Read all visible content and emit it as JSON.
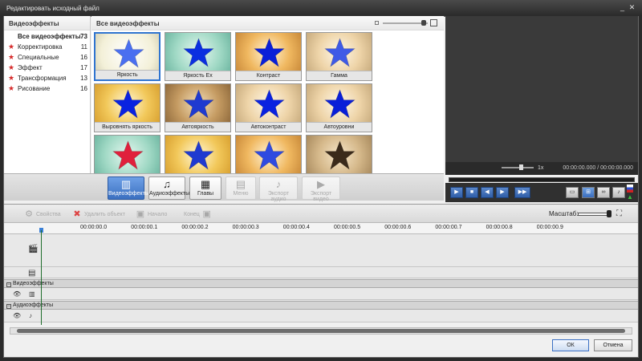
{
  "window": {
    "title": "Редактировать исходный файл"
  },
  "categories": {
    "header": "Видеоэффекты",
    "items": [
      {
        "label": "Все видеоэффекты",
        "count": "73"
      },
      {
        "label": "Корректировка",
        "count": "11"
      },
      {
        "label": "Специальные",
        "count": "16"
      },
      {
        "label": "Эффект",
        "count": "17"
      },
      {
        "label": "Трансформация",
        "count": "13"
      },
      {
        "label": "Рисование",
        "count": "16"
      }
    ]
  },
  "gallery": {
    "header": "Все видеоэффекты",
    "tiles": [
      {
        "label": "Яркость",
        "star_color": "#4a6ff0",
        "bg": "bg-white"
      },
      {
        "label": "Яркость Ex",
        "star_color": "#0a2fe0",
        "bg": "bg-teal"
      },
      {
        "label": "Контраст",
        "star_color": "#0a1fd8",
        "bg": "bg-orange"
      },
      {
        "label": "Гамма",
        "star_color": "#3f5ae6",
        "bg": "bg-tan"
      },
      {
        "label": "Выровнять яркость",
        "star_color": "#0a22e0",
        "bg": "bg-yellow"
      },
      {
        "label": "Автояркость",
        "star_color": "#1f3ad0",
        "bg": "bg-brown"
      },
      {
        "label": "Автоконтраст",
        "star_color": "#0a22e0",
        "bg": "bg-tan"
      },
      {
        "label": "Автоуровни",
        "star_color": "#0a1fd8",
        "bg": "bg-tan"
      },
      {
        "label": "",
        "star_color": "#e0203c",
        "bg": "bg-teal"
      },
      {
        "label": "",
        "star_color": "#1f3ad0",
        "bg": "bg-yellow"
      },
      {
        "label": "",
        "star_color": "#2f4ae0",
        "bg": "bg-orange"
      },
      {
        "label": "",
        "star_color": "#3a2a1a",
        "bg": "bg-dark"
      }
    ]
  },
  "tabs": [
    {
      "label": "Видеоэффекты",
      "state": "active"
    },
    {
      "label": "Аудиоэффекты",
      "state": "normal"
    },
    {
      "label": "Главы",
      "state": "normal"
    },
    {
      "label": "Меню",
      "state": "disabled"
    },
    {
      "label": "Экспорт аудио",
      "state": "disabled"
    },
    {
      "label": "Экспорт видео",
      "state": "disabled"
    }
  ],
  "preview": {
    "speed": "1x",
    "time": "00:00:00.000 / 00:00:00.000"
  },
  "timeline_toolbar": {
    "properties": "Свойства",
    "delete_object": "Удалить объект",
    "start": "Начало",
    "end": "Конец",
    "scale_label": "Масштаб:"
  },
  "ruler": {
    "ticks": [
      "00:00:00.0",
      "00:00:00.1",
      "00:00:00.2",
      "00:00:00.3",
      "00:00:00.4",
      "00:00:00.5",
      "00:00:00.6",
      "00:00:00.7",
      "00:00:00.8",
      "00:00:00.9"
    ]
  },
  "tracks": {
    "video_effects": "Видеоэффекты",
    "audio_effects": "Аудиоэффекты"
  },
  "footer": {
    "ok": "ОК",
    "cancel": "Отмена"
  }
}
